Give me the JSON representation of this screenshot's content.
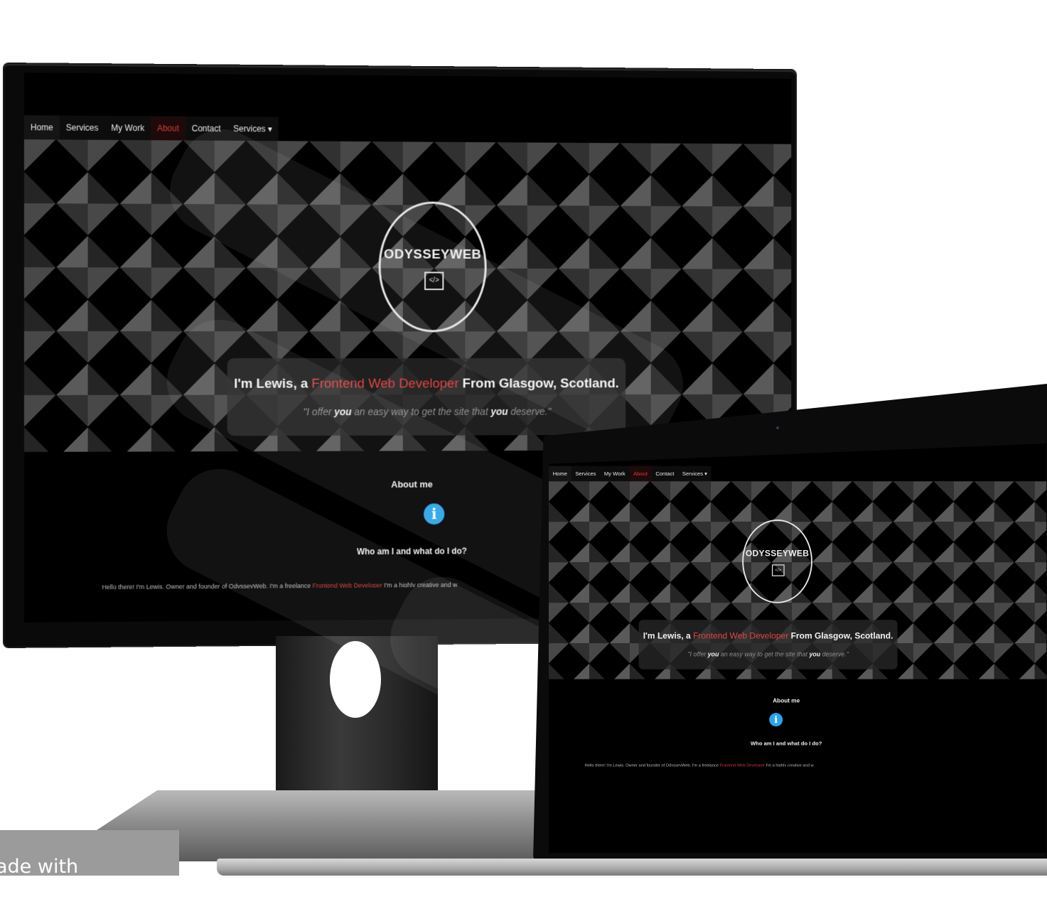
{
  "nav": {
    "items": [
      "Home",
      "Services",
      "My Work",
      "About",
      "Contact",
      "Services ▾"
    ],
    "active": "About"
  },
  "brand": {
    "logo": "ODYSSEYWEB",
    "code_icon": "</>"
  },
  "hero": {
    "intro": "I'm Lewis, a ",
    "role": "Frontend Web Developer",
    "location": " From Glasgow, Scotland.",
    "tagline_start": "\"I offer ",
    "tagline_you1": "you",
    "tagline_mid": " an easy way to get the site that ",
    "tagline_you2": "you",
    "tagline_end": " deserve.\""
  },
  "about": {
    "title": "About me",
    "subtitle": "Who am I and what do I do?",
    "bio_start": "Hello there! I'm Lewis, Owner and founder of OdysseyWeb. I'm a freelance ",
    "bio_role": "Frontend Web Developer",
    "bio_end": " I'm a highly creative and w"
  },
  "badge": {
    "text": "ade with"
  },
  "colors": {
    "accent": "#e04545",
    "info": "#2aa4e8"
  }
}
